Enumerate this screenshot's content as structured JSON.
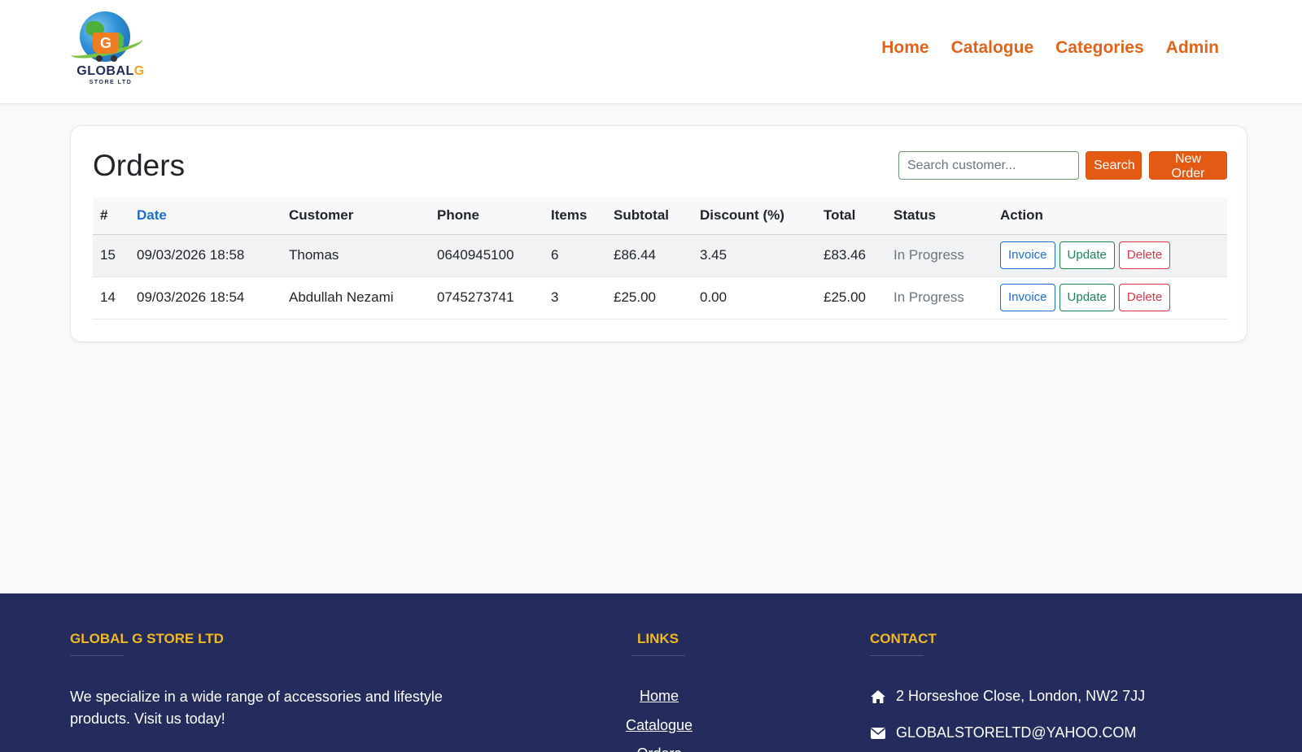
{
  "brand": {
    "logo_text_main": "GLOBAL",
    "logo_text_accent": "G",
    "logo_sub": "STORE LTD",
    "logo_cart_letter": "G"
  },
  "nav": {
    "items": [
      {
        "label": "Home"
      },
      {
        "label": "Catalogue"
      },
      {
        "label": "Categories"
      },
      {
        "label": "Admin"
      }
    ]
  },
  "orders": {
    "title": "Orders",
    "search_placeholder": "Search customer...",
    "search_label": "Search",
    "new_order_label": "New Order",
    "columns": [
      "#",
      "Date",
      "Customer",
      "Phone",
      "Items",
      "Subtotal",
      "Discount (%)",
      "Total",
      "Status",
      "Action"
    ],
    "rows": [
      {
        "id": "15",
        "date": "09/03/2026 18:58",
        "customer": "Thomas",
        "phone": "0640945100",
        "items": "6",
        "subtotal": "£86.44",
        "discount": "3.45",
        "total": "£83.46",
        "status": "In Progress"
      },
      {
        "id": "14",
        "date": "09/03/2026 18:54",
        "customer": "Abdullah Nezami",
        "phone": "0745273741",
        "items": "3",
        "subtotal": "£25.00",
        "discount": "0.00",
        "total": "£25.00",
        "status": "In Progress"
      }
    ],
    "actions": {
      "invoice": "Invoice",
      "update": "Update",
      "delete": "Delete"
    }
  },
  "footer": {
    "about_heading": "GLOBAL G STORE LTD",
    "about_text": "We specialize in a wide range of accessories and lifestyle products. Visit us today!",
    "links_heading": "LINKS",
    "links": [
      "Home",
      "Catalogue",
      "Orders"
    ],
    "contact_heading": "CONTACT",
    "address": "2 Horseshoe Close, London, NW2 7JJ",
    "email": "GLOBALSTORELTD@YAHOO.COM"
  },
  "colors": {
    "accent": "#e35a14",
    "nav": "#e0641a",
    "footer_bg": "#232c5c",
    "footer_heading": "#f2b824",
    "sort_link": "#1b6fd0"
  }
}
